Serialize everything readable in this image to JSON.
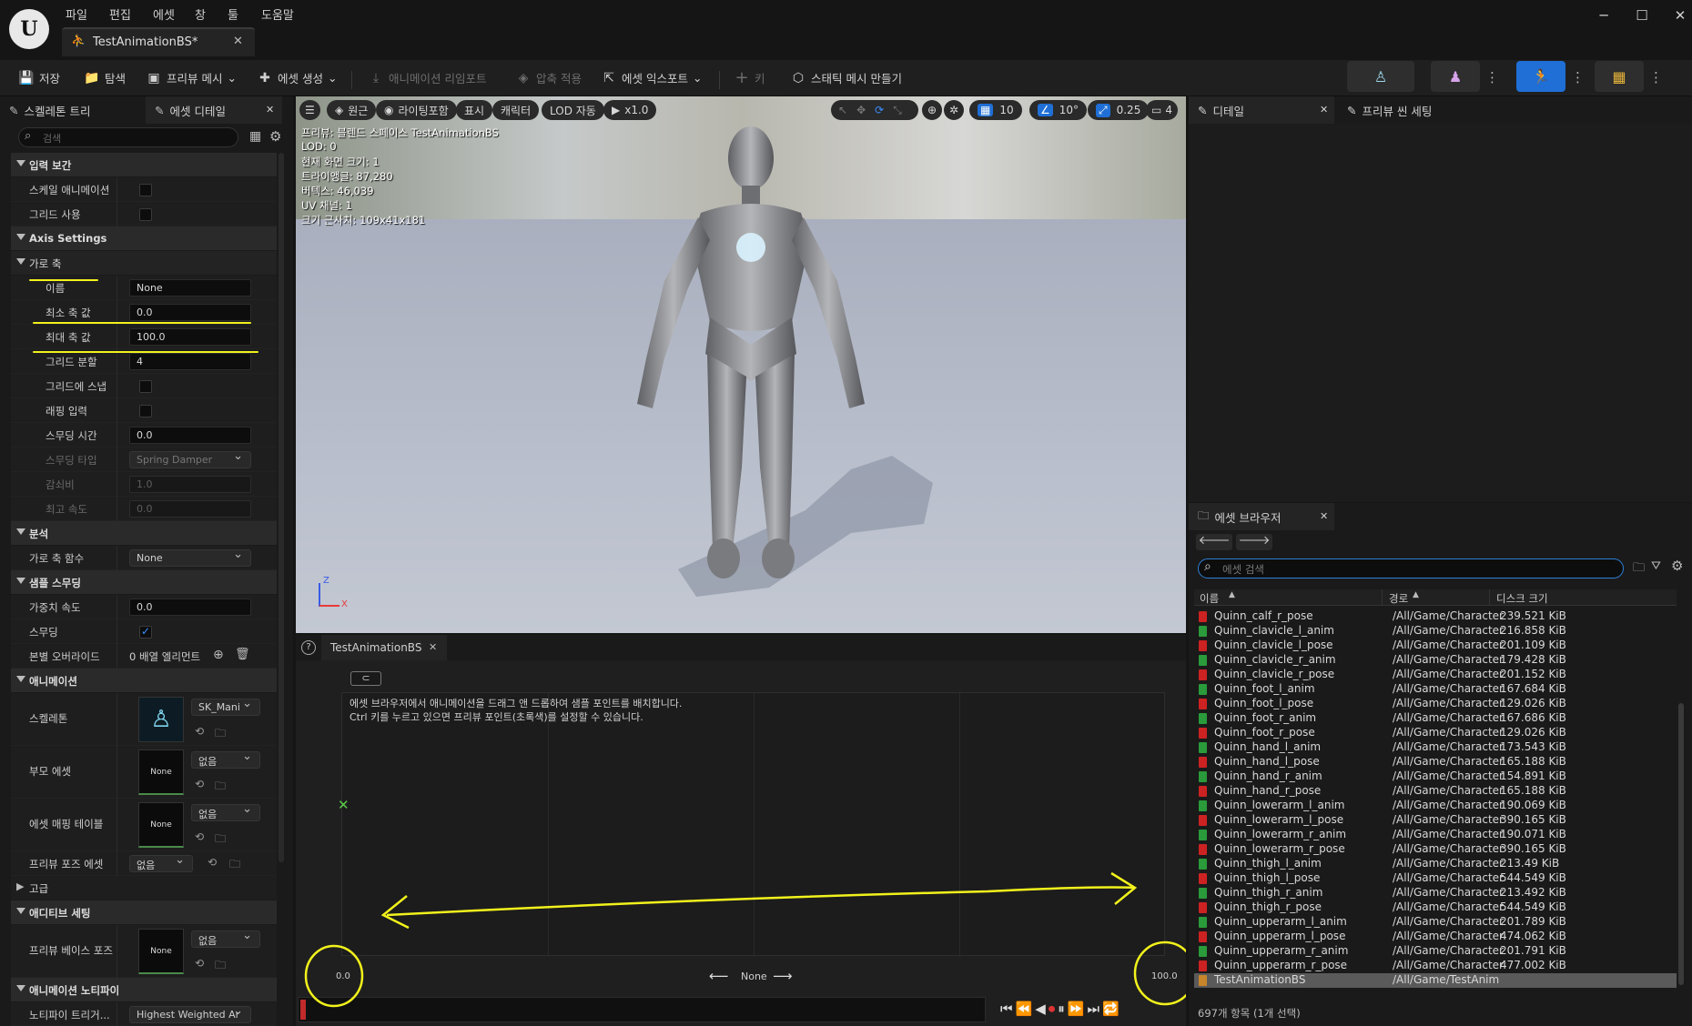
{
  "menu": [
    "파일",
    "편집",
    "에셋",
    "창",
    "툴",
    "도움말"
  ],
  "doc_tab": "TestAnimationBS*",
  "window_controls": [
    "─",
    "☐",
    "✕"
  ],
  "toolbar": {
    "save": "저장",
    "browse": "탐색",
    "preview_mesh": "프리뷰 메시",
    "create_asset": "에셋 생성",
    "reimport": "애니메이션 리임포트",
    "apply_compression": "압축 적용",
    "export_asset": "에셋 익스포트",
    "key": "키",
    "make_static_mesh": "스태틱 메시 만들기"
  },
  "left_panel": {
    "tabs": [
      "스켈레톤 트리",
      "에셋 디테일"
    ],
    "search_placeholder": "검색",
    "cat_input": "입력 보간",
    "scale_anim": "스케일 애니메이션",
    "use_grid": "그리드 사용",
    "cat_axis": "Axis Settings",
    "horizontal_axis": "가로 축",
    "name_label": "이름",
    "name_value": "None",
    "min_label": "최소 축 값",
    "min_value": "0.0",
    "max_label": "최대 축 값",
    "max_value": "100.0",
    "grid_div_label": "그리드 분할",
    "grid_div_value": "4",
    "snap_label": "그리드에 스냅",
    "wrap_label": "래핑 입력",
    "smooth_time_label": "스무딩 시간",
    "smooth_time_value": "0.0",
    "smooth_type_label": "스무딩 타입",
    "smooth_type_value": "Spring Damper",
    "damping_label": "감쇠비",
    "damping_value": "1.0",
    "max_speed_label": "최고 속도",
    "max_speed_value": "0.0",
    "cat_analysis": "분석",
    "h_axis_func_label": "가로 축 함수",
    "h_axis_func_value": "None",
    "cat_sample_smoothing": "샘플 스무딩",
    "weight_speed_label": "가중치 속도",
    "weight_speed_value": "0.0",
    "smoothing_label": "스무딩",
    "bone_override_label": "본별 오버라이드",
    "bone_override_value": "0 배열 엘리먼트",
    "cat_animation": "애니메이션",
    "skeleton_label": "스켈레톤",
    "skeleton_value": "SK_Mani",
    "parent_asset_label": "부모 에셋",
    "parent_asset_thumb": "None",
    "parent_asset_value": "없음",
    "mapping_table_label": "에셋 매핑 테이블",
    "mapping_table_thumb": "None",
    "mapping_table_value": "없음",
    "preview_pose_label": "프리뷰 포즈 에셋",
    "preview_pose_value": "없음",
    "cat_advanced": "고급",
    "cat_additive": "애디티브 세팅",
    "preview_base_label": "프리뷰 베이스 포즈",
    "preview_base_thumb": "None",
    "preview_base_value": "없음",
    "cat_notify": "애니메이션 노티파이",
    "notify_trigger_label": "노티파이 트리거...",
    "notify_trigger_value": "Highest Weighted Ar"
  },
  "viewport": {
    "perspective": "원근",
    "lit": "라이팅포함",
    "show": "표시",
    "character": "캐릭터",
    "lod": "LOD 자동",
    "play_rate": "x1.0",
    "grid_size": "10",
    "rot_snap": "10°",
    "scale_snap": "0.25",
    "cam_speed": "4",
    "stats": [
      "프리뷰: 블렌드 스페이스 TestAnimationBS",
      "LOD: 0",
      "현재 화면 크기: 1",
      "트라이앵글: 87,280",
      "버텍스: 46,039",
      "UV 채널: 1",
      "크기 근사치: 109x41x181"
    ],
    "axis_z": "Z",
    "axis_x": "X"
  },
  "blendspace": {
    "tab": "TestAnimationBS",
    "help_line1": "에셋 브라우저에서 애니메이션을 드래그 앤 드롭하여 샘플 포인트를 배치합니다.",
    "help_line2": "Ctrl 키를 누르고 있으면 프리뷰 포인트(초록색)를 설정할 수 있습니다.",
    "min_value": "0.0",
    "max_value": "100.0",
    "axis_name": "None"
  },
  "details": {
    "tabs": [
      "디테일",
      "프리뷰 씬 세팅"
    ]
  },
  "asset_browser": {
    "tab": "에셋 브라우저",
    "search_placeholder": "에셋 검색",
    "col_name": "이름",
    "col_path": "경로",
    "col_size": "디스크 크기",
    "rows": [
      {
        "name": "Quinn_calf_r_pose",
        "path": "/All/Game/Character",
        "size": "239.521 KiB",
        "color": "#cc2222"
      },
      {
        "name": "Quinn_clavicle_l_anim",
        "path": "/All/Game/Character",
        "size": "216.858 KiB",
        "color": "#2a9a3a"
      },
      {
        "name": "Quinn_clavicle_l_pose",
        "path": "/All/Game/Character",
        "size": "201.109 KiB",
        "color": "#cc2222"
      },
      {
        "name": "Quinn_clavicle_r_anim",
        "path": "/All/Game/Character",
        "size": "179.428 KiB",
        "color": "#2a9a3a"
      },
      {
        "name": "Quinn_clavicle_r_pose",
        "path": "/All/Game/Character",
        "size": "201.152 KiB",
        "color": "#cc2222"
      },
      {
        "name": "Quinn_foot_l_anim",
        "path": "/All/Game/Character",
        "size": "167.684 KiB",
        "color": "#2a9a3a"
      },
      {
        "name": "Quinn_foot_l_pose",
        "path": "/All/Game/Character",
        "size": "129.026 KiB",
        "color": "#cc2222"
      },
      {
        "name": "Quinn_foot_r_anim",
        "path": "/All/Game/Character",
        "size": "167.686 KiB",
        "color": "#2a9a3a"
      },
      {
        "name": "Quinn_foot_r_pose",
        "path": "/All/Game/Character",
        "size": "129.026 KiB",
        "color": "#cc2222"
      },
      {
        "name": "Quinn_hand_l_anim",
        "path": "/All/Game/Character",
        "size": "173.543 KiB",
        "color": "#2a9a3a"
      },
      {
        "name": "Quinn_hand_l_pose",
        "path": "/All/Game/Character",
        "size": "165.188 KiB",
        "color": "#cc2222"
      },
      {
        "name": "Quinn_hand_r_anim",
        "path": "/All/Game/Character",
        "size": "154.891 KiB",
        "color": "#2a9a3a"
      },
      {
        "name": "Quinn_hand_r_pose",
        "path": "/All/Game/Character",
        "size": "165.188 KiB",
        "color": "#cc2222"
      },
      {
        "name": "Quinn_lowerarm_l_anim",
        "path": "/All/Game/Character",
        "size": "190.069 KiB",
        "color": "#2a9a3a"
      },
      {
        "name": "Quinn_lowerarm_l_pose",
        "path": "/All/Game/Character",
        "size": "390.165 KiB",
        "color": "#cc2222"
      },
      {
        "name": "Quinn_lowerarm_r_anim",
        "path": "/All/Game/Character",
        "size": "190.071 KiB",
        "color": "#2a9a3a"
      },
      {
        "name": "Quinn_lowerarm_r_pose",
        "path": "/All/Game/Character",
        "size": "390.165 KiB",
        "color": "#cc2222"
      },
      {
        "name": "Quinn_thigh_l_anim",
        "path": "/All/Game/Character",
        "size": "213.49 KiB",
        "color": "#2a9a3a"
      },
      {
        "name": "Quinn_thigh_l_pose",
        "path": "/All/Game/Character",
        "size": "544.549 KiB",
        "color": "#cc2222"
      },
      {
        "name": "Quinn_thigh_r_anim",
        "path": "/All/Game/Character",
        "size": "213.492 KiB",
        "color": "#2a9a3a"
      },
      {
        "name": "Quinn_thigh_r_pose",
        "path": "/All/Game/Character",
        "size": "544.549 KiB",
        "color": "#cc2222"
      },
      {
        "name": "Quinn_upperarm_l_anim",
        "path": "/All/Game/Character",
        "size": "201.789 KiB",
        "color": "#2a9a3a"
      },
      {
        "name": "Quinn_upperarm_l_pose",
        "path": "/All/Game/Character",
        "size": "474.062 KiB",
        "color": "#cc2222"
      },
      {
        "name": "Quinn_upperarm_r_anim",
        "path": "/All/Game/Character",
        "size": "201.791 KiB",
        "color": "#2a9a3a"
      },
      {
        "name": "Quinn_upperarm_r_pose",
        "path": "/All/Game/Character",
        "size": "477.002 KiB",
        "color": "#cc2222"
      },
      {
        "name": "TestAnimationBS",
        "path": "/All/Game/TestAnim",
        "size": "",
        "color": "#c8852a",
        "selected": true
      }
    ],
    "status": "697개 항목 (1개 선택)"
  }
}
